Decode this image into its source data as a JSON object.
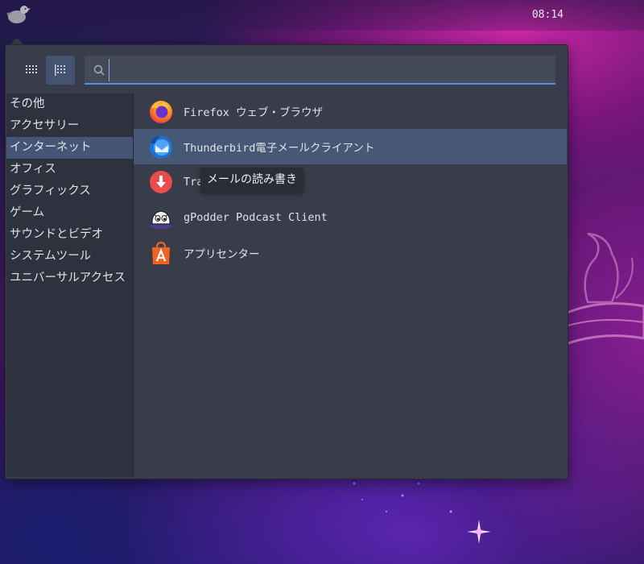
{
  "panel": {
    "clock": "08:14",
    "logo_icon": "bird-logo-icon"
  },
  "menu": {
    "view_grid_icon": "grid-view-icon",
    "view_list_icon": "list-view-icon",
    "search": {
      "value": "",
      "placeholder": "",
      "icon": "search-icon"
    },
    "categories": [
      {
        "label": "その他"
      },
      {
        "label": "アクセサリー"
      },
      {
        "label": "インターネット",
        "active": true
      },
      {
        "label": "オフィス"
      },
      {
        "label": "グラフィックス"
      },
      {
        "label": "ゲーム"
      },
      {
        "label": "サウンドとビデオ"
      },
      {
        "label": "システムツール"
      },
      {
        "label": "ユニバーサルアクセス"
      }
    ],
    "apps": [
      {
        "label": "Firefox ウェブ・ブラウザ",
        "icon": "firefox-icon"
      },
      {
        "label": "Thunderbird電子メールクライアント",
        "icon": "thunderbird-icon",
        "active": true
      },
      {
        "label": "Tra",
        "icon": "transmission-icon"
      },
      {
        "label": "gPodder Podcast Client",
        "icon": "gpodder-icon"
      },
      {
        "label": "アプリセンター",
        "icon": "app-center-icon"
      }
    ],
    "tooltip": "メールの読み書き"
  },
  "colors": {
    "accent": "#5b8ed6",
    "selection": "#475877",
    "menu_bg": "#393d4b",
    "sidebar_bg": "#2e323e"
  }
}
